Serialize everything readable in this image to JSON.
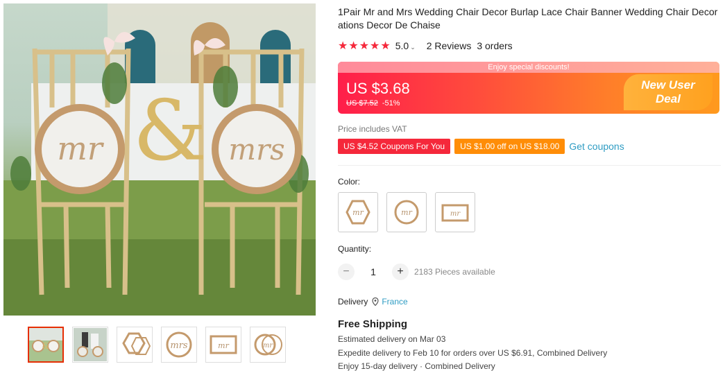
{
  "gallery": {
    "thumbnails": [
      {
        "name": "thumb-main-photo"
      },
      {
        "name": "thumb-bride-groom-photo"
      },
      {
        "name": "thumb-hexagon-sign"
      },
      {
        "name": "thumb-round-sign"
      },
      {
        "name": "thumb-rectangle-sign"
      },
      {
        "name": "thumb-round-pair-sign"
      }
    ],
    "sign_texts": {
      "left": "mr",
      "right": "mrs",
      "ampersand": "&"
    }
  },
  "product": {
    "title": "1Pair Mr and Mrs Wedding Chair Decor Burlap Lace Chair Banner Wedding Chair Decorations Decor De Chaise",
    "stars": "★★★★★",
    "rating": "5.0",
    "reviews": "2 Reviews",
    "orders": "3 orders"
  },
  "price": {
    "banner_text": "Enjoy special discounts!",
    "current": "US $3.68",
    "original": "US $7.52",
    "discount": "-51%",
    "deal_line1": "New User",
    "deal_line2": "Deal"
  },
  "vat_note": "Price includes VAT",
  "coupons": {
    "coupon1": "US $4.52 Coupons For You",
    "coupon2": "US $1.00 off on US $18.00",
    "get_label": "Get coupons"
  },
  "color": {
    "label": "Color:",
    "options": [
      "hexagon",
      "round",
      "rectangle"
    ]
  },
  "quantity": {
    "label": "Quantity:",
    "minus": "−",
    "plus": "+",
    "value": "1",
    "available": "2183 Pieces available"
  },
  "delivery": {
    "label": "Delivery",
    "country": "France"
  },
  "shipping": {
    "title": "Free Shipping",
    "line1": "Estimated delivery on Mar 03",
    "line2": "Expedite delivery to Feb 10 for orders over US $6.91, Combined Delivery",
    "line3": "Enjoy 15-day delivery · Combined Delivery"
  },
  "colors": {
    "accent_red": "#f5283b",
    "accent_orange": "#ff8d07",
    "link_blue": "#2e9cc3",
    "burlap": "#c49a6c"
  }
}
